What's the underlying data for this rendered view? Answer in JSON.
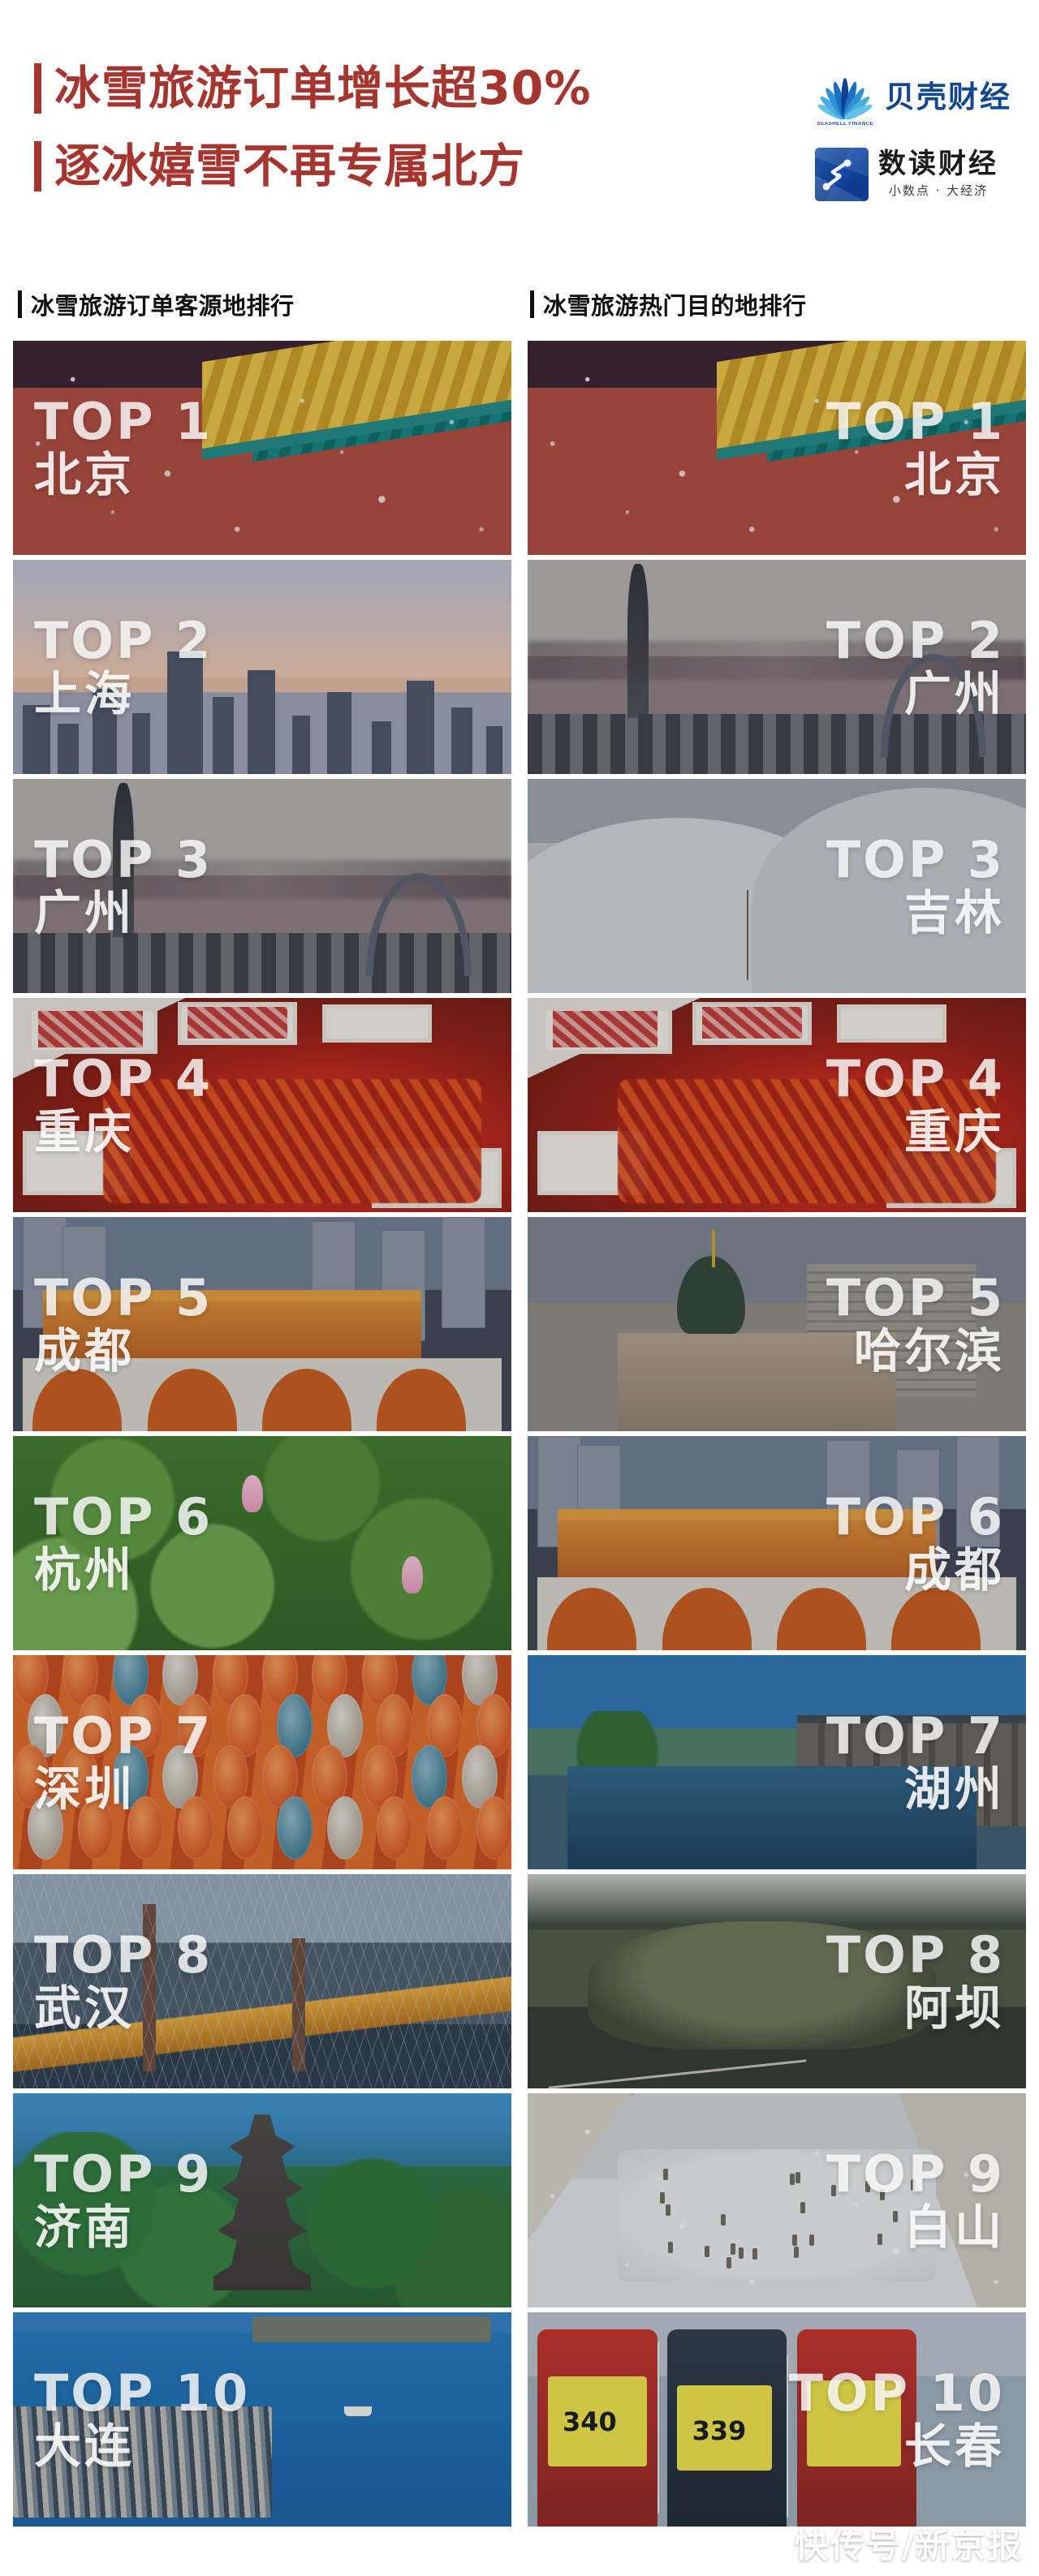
{
  "header": {
    "headline_line1": "冰雪旅游订单增长超30%",
    "headline_line2": "逐冰嬉雪不再专属北方",
    "accent_color": "#a63530",
    "logos": [
      {
        "icon": "shell-fan-icon",
        "name": "贝壳财经",
        "caption": "SEASHELL FINANCE",
        "color": "#10478f"
      },
      {
        "icon": "polygon-square-icon",
        "name": "数读财经",
        "tagline": "小数点 · 大经济",
        "color": "#1a1a1a"
      }
    ]
  },
  "columns": [
    {
      "id": "origin",
      "title": "冰雪旅游订单客源地排行",
      "align": "left"
    },
    {
      "id": "destination",
      "title": "冰雪旅游热门目的地排行",
      "align": "right"
    }
  ],
  "rankings": {
    "origin": [
      {
        "rank": "TOP 1",
        "city": "北京",
        "scene": "forbidden",
        "snow": true
      },
      {
        "rank": "TOP 2",
        "city": "上海",
        "scene": "shanghai",
        "snow": false
      },
      {
        "rank": "TOP 3",
        "city": "广州",
        "scene": "guangzhou",
        "snow": false
      },
      {
        "rank": "TOP 4",
        "city": "重庆",
        "scene": "hotpot",
        "snow": false
      },
      {
        "rank": "TOP 5",
        "city": "成都",
        "scene": "chengdu",
        "snow": false
      },
      {
        "rank": "TOP 6",
        "city": "杭州",
        "scene": "lotus",
        "snow": false
      },
      {
        "rank": "TOP 7",
        "city": "深圳",
        "scene": "lantern",
        "snow": false
      },
      {
        "rank": "TOP 8",
        "city": "武汉",
        "scene": "wuhan",
        "snow": false
      },
      {
        "rank": "TOP 9",
        "city": "济南",
        "scene": "jinan",
        "snow": false
      },
      {
        "rank": "TOP 10",
        "city": "大连",
        "scene": "dalian",
        "snow": false
      }
    ],
    "destination": [
      {
        "rank": "TOP 1",
        "city": "北京",
        "scene": "forbidden",
        "snow": true
      },
      {
        "rank": "TOP 2",
        "city": "广州",
        "scene": "guangzhou",
        "snow": false
      },
      {
        "rank": "TOP 3",
        "city": "吉林",
        "scene": "snowhill",
        "snow": false
      },
      {
        "rank": "TOP 4",
        "city": "重庆",
        "scene": "hotpot",
        "snow": false
      },
      {
        "rank": "TOP 5",
        "city": "哈尔滨",
        "scene": "harbin",
        "snow": false
      },
      {
        "rank": "TOP 6",
        "city": "成都",
        "scene": "chengdu",
        "snow": false
      },
      {
        "rank": "TOP 7",
        "city": "湖州",
        "scene": "huzhou",
        "snow": false
      },
      {
        "rank": "TOP 8",
        "city": "阿坝",
        "scene": "aba",
        "snow": false
      },
      {
        "rank": "TOP 9",
        "city": "白山",
        "scene": "baishan",
        "snow": true
      },
      {
        "rank": "TOP 10",
        "city": "长春",
        "scene": "ski",
        "snow": false
      }
    ]
  },
  "ski_bib_numbers": [
    "340",
    "339"
  ],
  "watermark": "快传号/新京报"
}
